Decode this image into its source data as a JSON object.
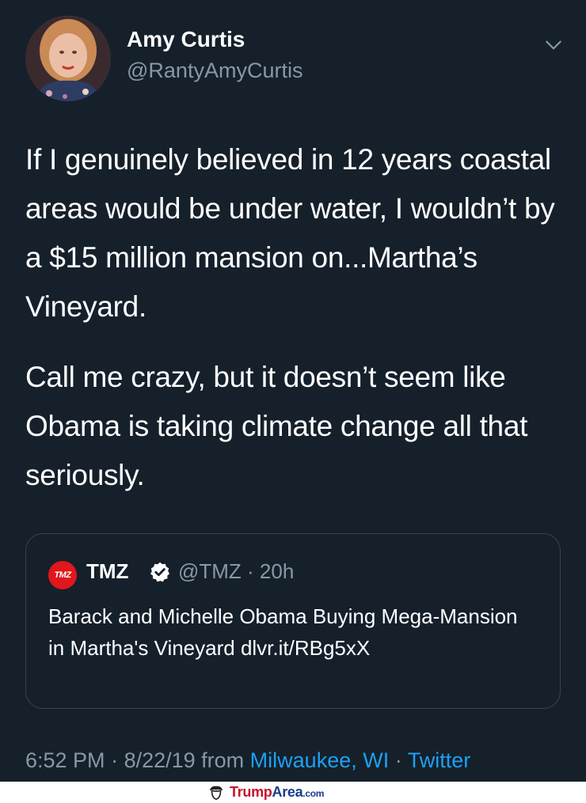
{
  "author": {
    "name": "Amy Curtis",
    "handle": "@RantyAmyCurtis"
  },
  "tweet": {
    "paragraphs": [
      "If I genuinely believed in 12 years coastal areas would be under water, I wouldn’t by a $15 million mansion on...Martha’s Vineyard.",
      "Call me crazy, but it doesn’t seem like Obama is taking climate change all that seriously."
    ]
  },
  "quoted_tweet": {
    "avatar_text": "TMZ",
    "name": "TMZ",
    "handle_time": "@TMZ · 20h",
    "text": "Barack and Michelle Obama Buying Mega-Mansion in Martha's Vineyard dlvr.it/RBg5xX"
  },
  "meta": {
    "time": "6:52 PM",
    "sep1": " · ",
    "date": "8/22/19",
    "from": " from ",
    "location": "Milwaukee, WI",
    "sep2": " · ",
    "source": "Twitter"
  },
  "watermark": {
    "brand_a": "Trump",
    "brand_b": "Area",
    "tld": ".com"
  },
  "colors": {
    "background": "#15202b",
    "secondary_text": "#8899a6",
    "link": "#1da1f2",
    "border": "#38444d"
  },
  "icons": [
    "chevron-down-icon",
    "verified-badge-icon",
    "trumparea-logo-icon"
  ]
}
